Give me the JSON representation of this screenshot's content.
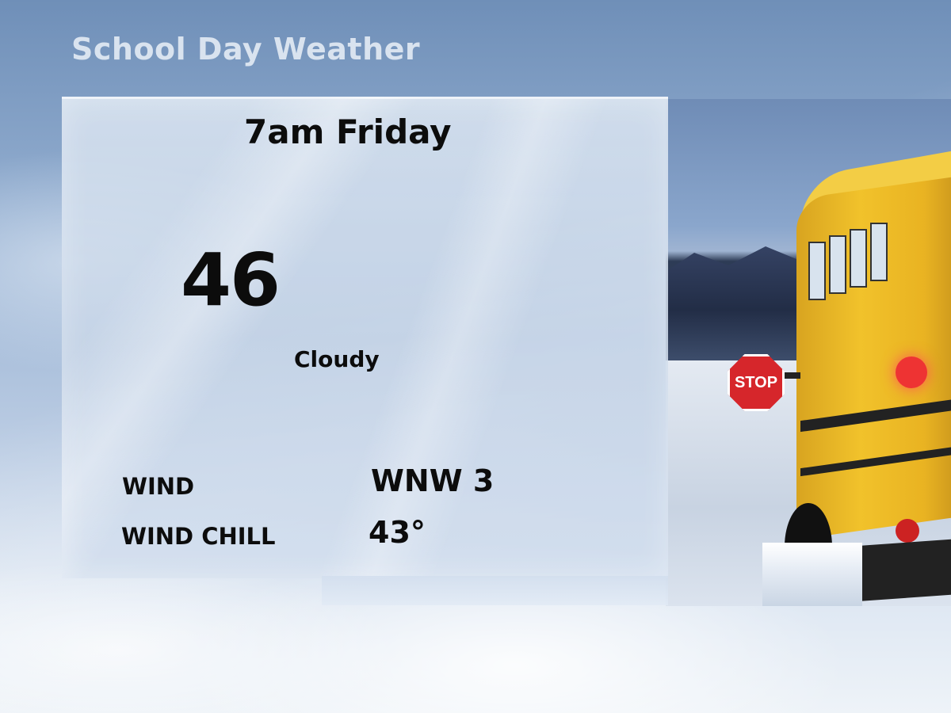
{
  "header": {
    "title": "School Day Weather"
  },
  "forecast": {
    "time_label": "7am Friday",
    "temperature": "46",
    "condition": "Cloudy",
    "wind_label": "WIND",
    "wind_value": "WNW 3",
    "wind_chill_label": "WIND CHILL",
    "wind_chill_value": "43°"
  },
  "photo": {
    "stop_sign_text": "STOP"
  },
  "colors": {
    "title": "#d9e3ef",
    "text": "#0c0c0c",
    "bus_yellow": "#f1c22b",
    "stop_red": "#d6262b"
  }
}
